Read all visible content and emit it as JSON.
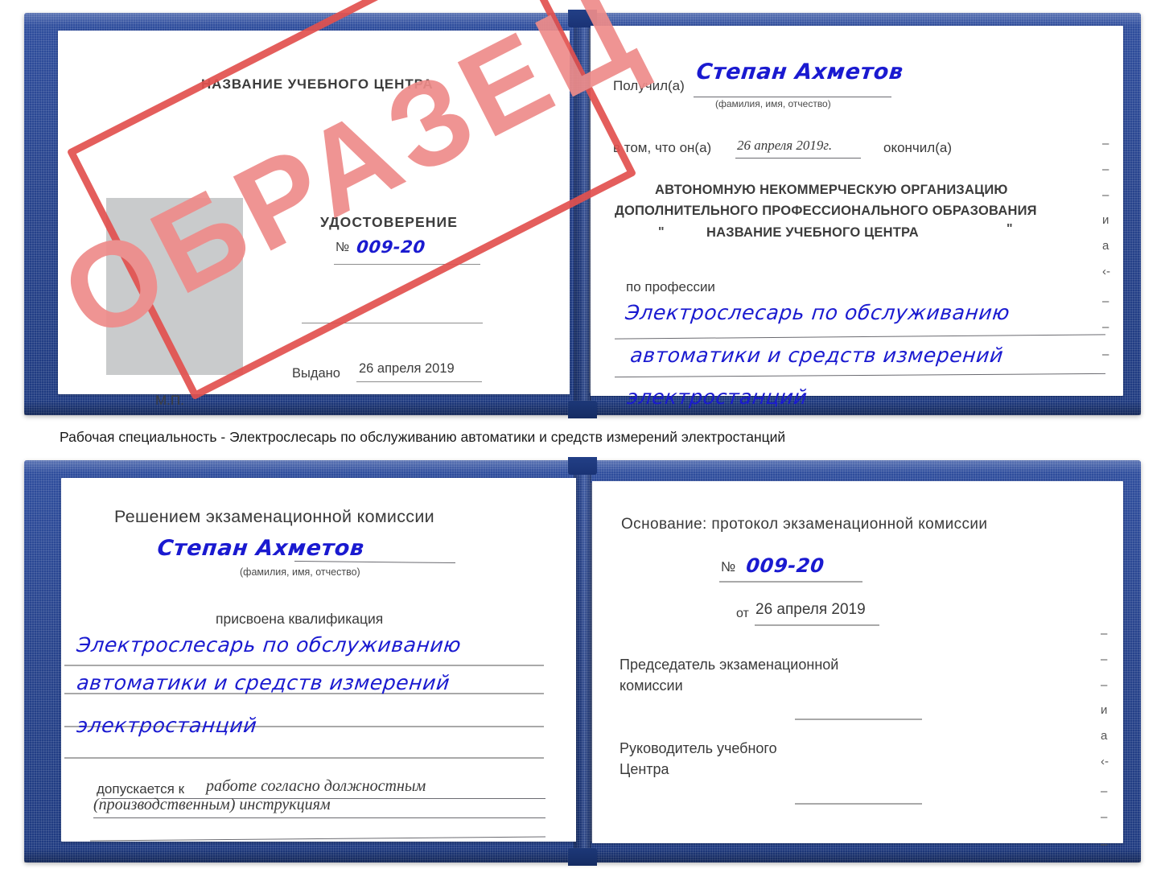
{
  "document": {
    "type": "certificate-scan",
    "stamp_label": "ОБРАЗЕЦ",
    "accent_blue": "#27438c",
    "stamp_red": "#e2514f",
    "ink_blue": "#1a1ad0"
  },
  "caption": {
    "text": "Рабочая специальность - Электрослесарь по обслуживанию автоматики и средств измерений электростанций"
  },
  "certificate_top": {
    "left_page": {
      "center_name": "НАЗВАНИЕ УЧЕБНОГО ЦЕНТРА",
      "title": "УДОСТОВЕРЕНИЕ",
      "number_label": "№",
      "number_value": "009-20",
      "issued_label": "Выдано",
      "issued_value": "26 апреля 2019",
      "stamp_place": "М.П."
    },
    "right_page": {
      "received_label": "Получил(а)",
      "received_value": "Степан Ахметов",
      "name_hint": "(фамилия, имя, отчество)",
      "that_he_label": "в том, что он(а)",
      "that_he_value": "26 апреля 2019г.",
      "finished_label": "окончил(а)",
      "org_line1": "АВТОНОМНУЮ НЕКОММЕРЧЕСКУЮ ОРГАНИЗАЦИЮ",
      "org_line2": "ДОПОЛНИТЕЛЬНОГО ПРОФЕССИОНАЛЬНОГО ОБРАЗОВАНИЯ",
      "org_quote_open": "\"",
      "org_line3": "НАЗВАНИЕ УЧЕБНОГО ЦЕНТРА",
      "org_quote_close": "\"",
      "profession_label": "по профессии",
      "profession_line1": "Электрослесарь по обслуживанию",
      "profession_line2": "автоматики и средств измерений",
      "profession_line3": "электростанций",
      "edge_marks": [
        "–",
        "–",
        "–",
        "и",
        "а",
        "‹-",
        "–",
        "–",
        "–"
      ]
    }
  },
  "certificate_bottom": {
    "left_page": {
      "heading": "Решением экзаменационной комиссии",
      "name_value": "Степан Ахметов",
      "name_hint": "(фамилия, имя, отчество)",
      "qualification_label": "присвоена квалификация",
      "qualification_line1": "Электрослесарь по обслуживанию",
      "qualification_line2": "автоматики и средств измерений",
      "qualification_line3": "электростанций",
      "admitted_label": "допускается к",
      "admitted_line1": "работе согласно должностным",
      "admitted_line2": "(производственным) инструкциям"
    },
    "right_page": {
      "basis_label": "Основание: протокол экзаменационной комиссии",
      "number_label": "№",
      "number_value": "009-20",
      "date_label": "от",
      "date_value": "26 апреля 2019",
      "chairman_line1": "Председатель экзаменационной",
      "chairman_line2": "комиссии",
      "head_line1": "Руководитель учебного",
      "head_line2": "Центра",
      "edge_marks": [
        "–",
        "–",
        "–",
        "и",
        "а",
        "‹-",
        "–",
        "–",
        "–"
      ]
    }
  }
}
